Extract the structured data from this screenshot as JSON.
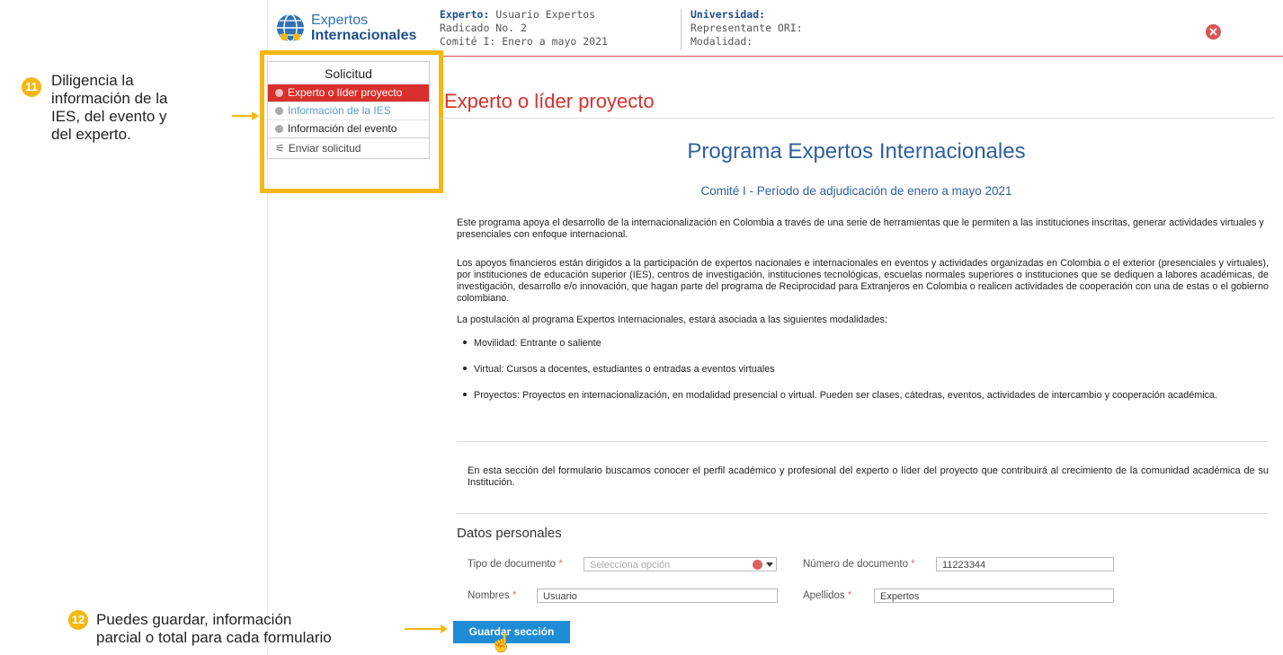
{
  "header": {
    "logo_line1": "Expertos",
    "logo_line2": "Internacionales",
    "col1": {
      "l1_label": "Experto:",
      "l1_value": " Usuario Expertos",
      "l2": "Radicado No. 2",
      "l3": "Comité I: Enero a mayo 2021"
    },
    "col2": {
      "l1_label": "Universidad:",
      "l2": "Representante ORI:",
      "l3": "Modalidad:"
    },
    "close_symbol": "✕"
  },
  "sidebar": {
    "title": "Solicitud",
    "items": [
      {
        "label": "Experto o líder proyecto"
      },
      {
        "label": "Información de la IES"
      },
      {
        "label": "Información del evento"
      }
    ],
    "send_label": "Enviar solicitud",
    "send_icon": "⚟"
  },
  "annotations": {
    "a11": {
      "num": "11",
      "lines": [
        "Diligencia la",
        "información de la",
        "IES, del evento y",
        "del experto."
      ]
    },
    "a12": {
      "num": "12",
      "lines": [
        "Puedes guardar, información",
        "parcial o total para cada formulario"
      ]
    }
  },
  "main": {
    "section_title": "Experto o líder proyecto",
    "program_title": "Programa Expertos Internacionales",
    "program_subtitle": "Comité I - Período de adjudicación de enero a mayo 2021",
    "p1": "Este programa apoya el desarrollo de la internacionalización en Colombia a través de una serie de herramientas que le permiten a las instituciones inscritas, generar actividades virtuales y presenciales con enfoque internacional.",
    "p2": "Los apoyos financieros están dirigidos a la participación de expertos nacionales e internacionales en eventos y actividades organizadas en Colombia o el exterior (presenciales y virtuales), por instituciones de educación superior (IES), centros de investigación, instituciones tecnológicas, escuelas normales superiores o instituciones que se dediquen a labores académicas, de investigación, desarrollo e/o innovación, que hagan parte del programa de Reciprocidad para Extranjeros en Colombia o realicen actividades de cooperación con una de estas o el gobierno colombiano.",
    "p3": "La postulación al programa Expertos Internacionales, estará asociada a las siguientes modalidades:",
    "bullets": [
      "Movilidad: Entrante o saliente",
      "Virtual: Cursos a docentes, estudiantes o entradas a eventos virtuales",
      "Proyectos: Proyectos en internacionalización, en modalidad presencial o virtual. Pueden ser clases, cátedras, eventos, actividades de intercambio y cooperación académica."
    ],
    "intro": "En esta sección del formulario buscamos conocer el perfil académico y profesional del experto o líder del proyecto que contribuirá al crecimiento de la comunidad académica de su Institución.",
    "datos_title": "Datos personales",
    "form": {
      "tipo_label": "Tipo de documento",
      "tipo_placeholder": "Selecciona opción",
      "numero_label": "Número de documento",
      "numero_value": "11223344",
      "nombres_label": "Nombres",
      "nombres_value": "Usuario",
      "apellidos_label": "Apellidos",
      "apellidos_value": "Expertos",
      "required_mark": "*"
    },
    "save_label": "Guardar sección",
    "cursor_symbol": "☝"
  }
}
